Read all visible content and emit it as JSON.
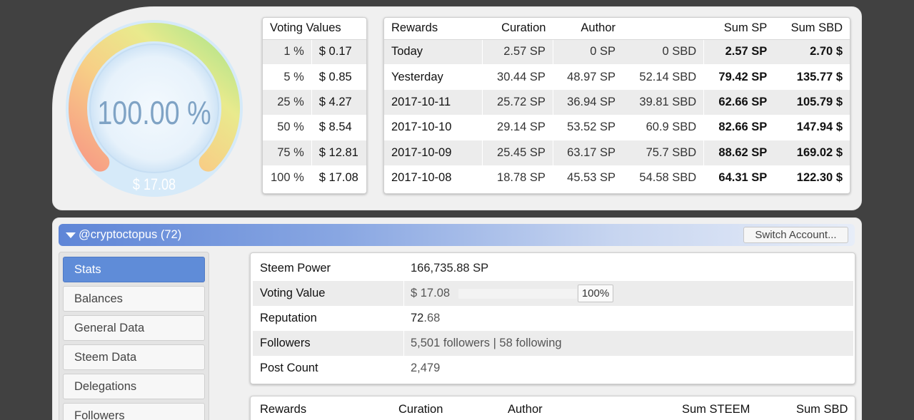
{
  "gauge": {
    "percent_label": "100.00 %",
    "value_label": "$ 17.08",
    "fill_fraction": 1.0
  },
  "voting_values": {
    "header": "Voting Values",
    "rows": [
      {
        "pct": "1 %",
        "value": "$ 0.17"
      },
      {
        "pct": "5 %",
        "value": "$ 0.85"
      },
      {
        "pct": "25 %",
        "value": "$ 4.27"
      },
      {
        "pct": "50 %",
        "value": "$ 8.54"
      },
      {
        "pct": "75 %",
        "value": "$ 12.81"
      },
      {
        "pct": "100 %",
        "value": "$ 17.08"
      }
    ]
  },
  "rewards_top": {
    "headers": {
      "rewards": "Rewards",
      "curation": "Curation",
      "author": "Author",
      "author_sbd": "",
      "sum_sp": "Sum SP",
      "sum_sbd": "Sum SBD"
    },
    "rows": [
      {
        "label": "Today",
        "curation": "2.57 SP",
        "author_sp": "0 SP",
        "author_sbd": "0 SBD",
        "sum_sp": "2.57 SP",
        "sum_sbd": "2.70 $"
      },
      {
        "label": "Yesterday",
        "curation": "30.44 SP",
        "author_sp": "48.97 SP",
        "author_sbd": "52.14 SBD",
        "sum_sp": "79.42 SP",
        "sum_sbd": "135.77 $"
      },
      {
        "label": "2017-10-11",
        "curation": "25.72 SP",
        "author_sp": "36.94 SP",
        "author_sbd": "39.81 SBD",
        "sum_sp": "62.66 SP",
        "sum_sbd": "105.79 $"
      },
      {
        "label": "2017-10-10",
        "curation": "29.14 SP",
        "author_sp": "53.52 SP",
        "author_sbd": "60.9 SBD",
        "sum_sp": "82.66 SP",
        "sum_sbd": "147.94 $"
      },
      {
        "label": "2017-10-09",
        "curation": "25.45 SP",
        "author_sp": "63.17 SP",
        "author_sbd": "75.7 SBD",
        "sum_sp": "88.62 SP",
        "sum_sbd": "169.02 $"
      },
      {
        "label": "2017-10-08",
        "curation": "18.78 SP",
        "author_sp": "45.53 SP",
        "author_sbd": "54.58 SBD",
        "sum_sp": "64.31 SP",
        "sum_sbd": "122.30 $"
      }
    ]
  },
  "account": {
    "name": "@cryptoctopus (72)",
    "switch_label": "Switch Account..."
  },
  "nav": {
    "items": [
      "Stats",
      "Balances",
      "General Data",
      "Steem Data",
      "Delegations",
      "Followers"
    ],
    "active": "Stats"
  },
  "stats": {
    "steem_power": {
      "label": "Steem Power",
      "value": "166,735.88 SP"
    },
    "voting_value": {
      "label": "Voting Value",
      "value": "$ 17.08",
      "percent": "100%",
      "fill_fraction": 1.0
    },
    "reputation": {
      "label": "Reputation",
      "int_part": "72",
      "dec_part": ".68"
    },
    "followers": {
      "label": "Followers",
      "value": "5,501 followers | 58 following"
    },
    "post_count": {
      "label": "Post Count",
      "value": "2,479"
    }
  },
  "rewards_bottom": {
    "headers": {
      "rewards": "Rewards",
      "curation": "Curation",
      "author": "Author",
      "sum_steem": "Sum STEEM",
      "sum_sbd": "Sum SBD"
    }
  },
  "colors": {
    "accent_blue": "#5f8cd8",
    "page_bg": "#414141",
    "panel_bg": "#f0f0f0"
  }
}
